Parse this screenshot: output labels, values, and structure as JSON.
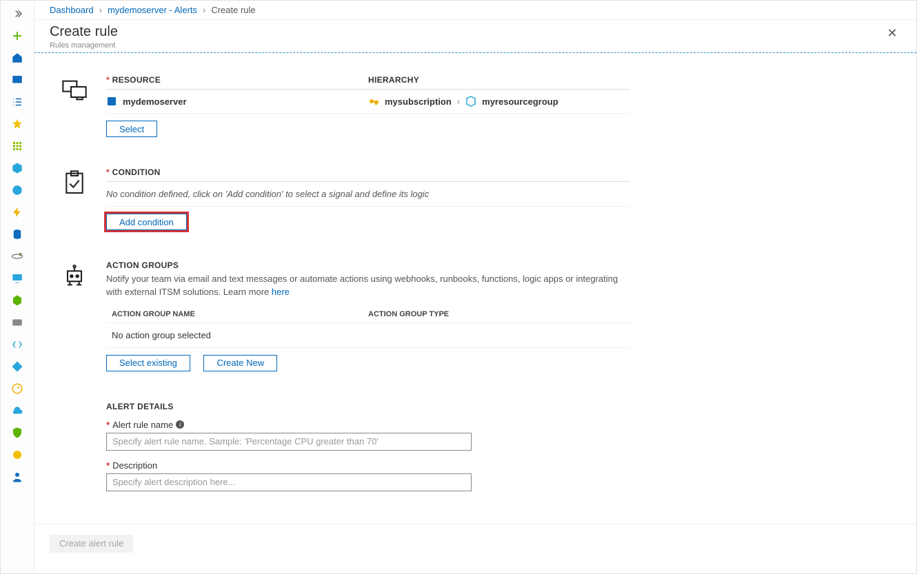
{
  "breadcrumb": {
    "dashboard": "Dashboard",
    "alerts": "mydemoserver - Alerts",
    "create": "Create rule"
  },
  "title": "Create rule",
  "subtitle": "Rules management",
  "resource": {
    "heading": "RESOURCE",
    "value": "mydemoserver",
    "select_btn": "Select"
  },
  "hierarchy": {
    "heading": "HIERARCHY",
    "subscription": "mysubscription",
    "resourcegroup": "myresourcegroup"
  },
  "condition": {
    "heading": "CONDITION",
    "empty_text": "No condition defined, click on 'Add condition' to select a signal and define its logic",
    "add_btn": "Add condition"
  },
  "action_groups": {
    "heading": "ACTION GROUPS",
    "desc": "Notify your team via email and text messages or automate actions using webhooks, runbooks, functions, logic apps or integrating with external ITSM solutions. Learn more ",
    "learn_more": "here",
    "col_name": "ACTION GROUP NAME",
    "col_type": "ACTION GROUP TYPE",
    "none": "No action group selected",
    "select_existing": "Select existing",
    "create_new": "Create New"
  },
  "alert_details": {
    "heading": "ALERT DETAILS",
    "name_label": "Alert rule name",
    "name_placeholder": "Specify alert rule name. Sample: 'Percentage CPU greater than 70'",
    "desc_label": "Description",
    "desc_placeholder": "Specify alert description here..."
  },
  "footer": {
    "create_btn": "Create alert rule"
  }
}
